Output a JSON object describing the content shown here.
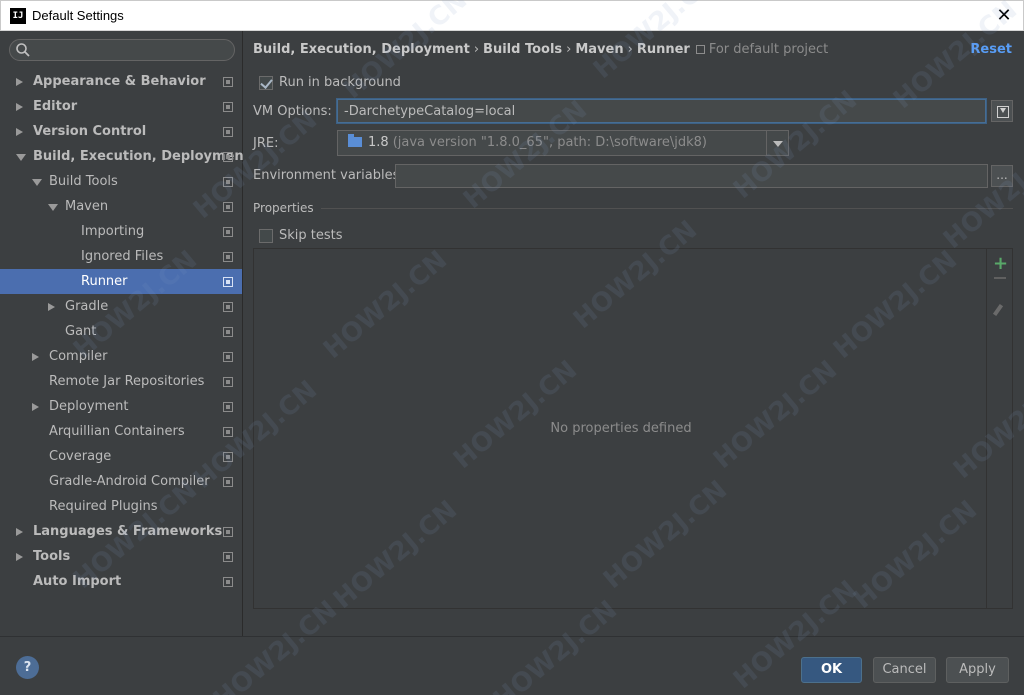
{
  "window": {
    "title": "Default Settings",
    "app_icon": "IJ"
  },
  "sidebar": {
    "search": {
      "value": "",
      "placeholder": ""
    },
    "items": [
      {
        "label": "Appearance & Behavior",
        "bold": true,
        "arrow": "right",
        "level": 0,
        "project_icon": true
      },
      {
        "label": "Editor",
        "bold": true,
        "arrow": "right",
        "level": 0,
        "project_icon": true
      },
      {
        "label": "Version Control",
        "bold": true,
        "arrow": "right",
        "level": 0,
        "project_icon": true
      },
      {
        "label": "Build, Execution, Deployment",
        "bold": true,
        "arrow": "down",
        "level": 0,
        "project_icon": true
      },
      {
        "label": "Build Tools",
        "bold": false,
        "arrow": "down",
        "level": 1,
        "project_icon": true
      },
      {
        "label": "Maven",
        "bold": false,
        "arrow": "down",
        "level": 2,
        "project_icon": true
      },
      {
        "label": "Importing",
        "bold": false,
        "arrow": "none",
        "level": 3,
        "project_icon": true
      },
      {
        "label": "Ignored Files",
        "bold": false,
        "arrow": "none",
        "level": 3,
        "project_icon": true
      },
      {
        "label": "Runner",
        "bold": false,
        "arrow": "none",
        "level": 3,
        "project_icon": true,
        "selected": true
      },
      {
        "label": "Gradle",
        "bold": false,
        "arrow": "right",
        "level": 2,
        "project_icon": true
      },
      {
        "label": "Gant",
        "bold": false,
        "arrow": "none",
        "level": 2,
        "project_icon": true
      },
      {
        "label": "Compiler",
        "bold": false,
        "arrow": "right",
        "level": 1,
        "project_icon": true
      },
      {
        "label": "Remote Jar Repositories",
        "bold": false,
        "arrow": "none",
        "level": 1,
        "project_icon": true
      },
      {
        "label": "Deployment",
        "bold": false,
        "arrow": "right",
        "level": 1,
        "project_icon": true
      },
      {
        "label": "Arquillian Containers",
        "bold": false,
        "arrow": "none",
        "level": 1,
        "project_icon": true
      },
      {
        "label": "Coverage",
        "bold": false,
        "arrow": "none",
        "level": 1,
        "project_icon": true
      },
      {
        "label": "Gradle-Android Compiler",
        "bold": false,
        "arrow": "none",
        "level": 1,
        "project_icon": true
      },
      {
        "label": "Required Plugins",
        "bold": false,
        "arrow": "none",
        "level": 1,
        "project_icon": false
      },
      {
        "label": "Languages & Frameworks",
        "bold": true,
        "arrow": "right",
        "level": 0,
        "project_icon": true
      },
      {
        "label": "Tools",
        "bold": true,
        "arrow": "right",
        "level": 0,
        "project_icon": true
      },
      {
        "label": "Auto Import",
        "bold": true,
        "arrow": "none",
        "level": 0,
        "project_icon": true
      }
    ]
  },
  "breadcrumb": {
    "parts": [
      "Build, Execution, Deployment",
      "Build Tools",
      "Maven",
      "Runner"
    ],
    "separator": "›",
    "scope": "For default project"
  },
  "reset_label": "Reset",
  "runner": {
    "run_in_background": {
      "label": "Run in background",
      "checked": true
    },
    "vm_options": {
      "label": "VM Options:",
      "value": "-DarchetypeCatalog=local"
    },
    "jre": {
      "label": "JRE:",
      "version": "1.8",
      "detail": "(java version \"1.8.0_65\", path: D:\\software\\jdk8)"
    },
    "env_vars": {
      "label": "Environment variables:",
      "value": "",
      "browse_label": "..."
    },
    "properties": {
      "section_title": "Properties",
      "skip_tests": {
        "label": "Skip tests",
        "checked": false
      },
      "empty_text": "No properties defined",
      "add_label": "+"
    }
  },
  "footer": {
    "help_label": "?",
    "ok_label": "OK",
    "cancel_label": "Cancel",
    "apply_label": "Apply"
  },
  "watermark": "HOW2J.CN",
  "colors": {
    "background": "#3c3f41",
    "selection": "#4b6eaf",
    "accent_link": "#589df6",
    "add_green": "#59a869",
    "primary_button": "#365880"
  }
}
